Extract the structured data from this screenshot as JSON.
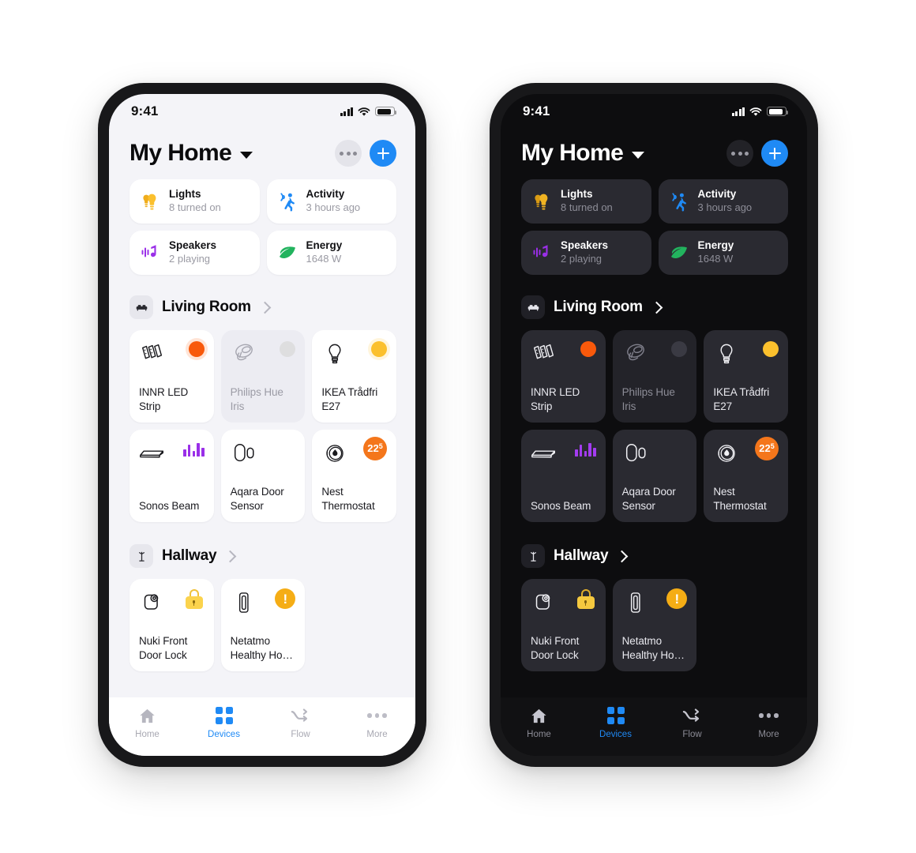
{
  "status_bar": {
    "time": "9:41",
    "icons": [
      "cellular-signal-icon",
      "wifi-icon",
      "battery-icon"
    ]
  },
  "header": {
    "title": "My Home",
    "dropdown_icon": "chevron-down-icon",
    "more_button_label": "•••",
    "add_button_label": "+",
    "accent_color": "#1f8af5"
  },
  "summary_cards": [
    {
      "icon": "lightbulb-icon",
      "title": "Lights",
      "subtitle": "8 turned on",
      "color": "#f5b722"
    },
    {
      "icon": "motion-sensor-icon",
      "title": "Activity",
      "subtitle": "3 hours ago",
      "color": "#1f8af5"
    },
    {
      "icon": "music-note-icon",
      "title": "Speakers",
      "subtitle": "2 playing",
      "color": "#9a2fe8"
    },
    {
      "icon": "leaf-icon",
      "title": "Energy",
      "subtitle": "1648 W",
      "color": "#22b35e"
    }
  ],
  "rooms": [
    {
      "name": "Living Room",
      "icon": "sofa-icon",
      "chevron": "chevron-right-icon",
      "devices": [
        {
          "name": "INNR LED Strip",
          "icon": "led-strip-icon",
          "state": "on",
          "indicator": "dot",
          "indicator_color": "#f8590b"
        },
        {
          "name": "Philips Hue Iris",
          "icon": "hue-iris-lamp-icon",
          "state": "off",
          "indicator": "dot",
          "indicator_color": "#dededf"
        },
        {
          "name": "IKEA Trådfri E27",
          "icon": "light-bulb-icon",
          "state": "on",
          "indicator": "dot",
          "indicator_color": "#fbc02d"
        },
        {
          "name": "Sonos Beam",
          "icon": "soundbar-icon",
          "state": "on",
          "indicator": "equalizer",
          "indicator_color": "#9a2fe8"
        },
        {
          "name": "Aqara Door Sensor",
          "icon": "door-sensor-icon",
          "state": "on",
          "indicator": "none",
          "indicator_color": ""
        },
        {
          "name": "Nest Thermostat",
          "icon": "thermostat-icon",
          "state": "on",
          "indicator": "badge",
          "indicator_color": "#f4761b",
          "badge_value": "22",
          "badge_sup": "5"
        }
      ]
    },
    {
      "name": "Hallway",
      "icon": "coat-rack-icon",
      "chevron": "chevron-right-icon",
      "devices": [
        {
          "name": "Nuki Front Door Lock",
          "icon": "smart-lock-icon",
          "state": "on",
          "indicator": "lock",
          "indicator_color": "#fbd34d"
        },
        {
          "name": "Netatmo Healthy Ho…",
          "icon": "air-sensor-icon",
          "state": "on",
          "indicator": "warning",
          "indicator_color": "#f5ad15"
        }
      ]
    }
  ],
  "tab_bar": {
    "active": "Devices",
    "tabs": [
      {
        "label": "Home",
        "icon": "home-icon"
      },
      {
        "label": "Devices",
        "icon": "grid-icon"
      },
      {
        "label": "Flow",
        "icon": "flow-arrows-icon"
      },
      {
        "label": "More",
        "icon": "ellipsis-icon"
      }
    ]
  },
  "themes": {
    "light": {
      "name": "light",
      "screen_bg": "#f4f4f8",
      "card_bg": "#ffffff",
      "text": "#0b0b0d"
    },
    "dark": {
      "name": "dark",
      "screen_bg": "#0d0d0f",
      "card_bg": "#2a2a31",
      "text": "#ffffff"
    }
  }
}
